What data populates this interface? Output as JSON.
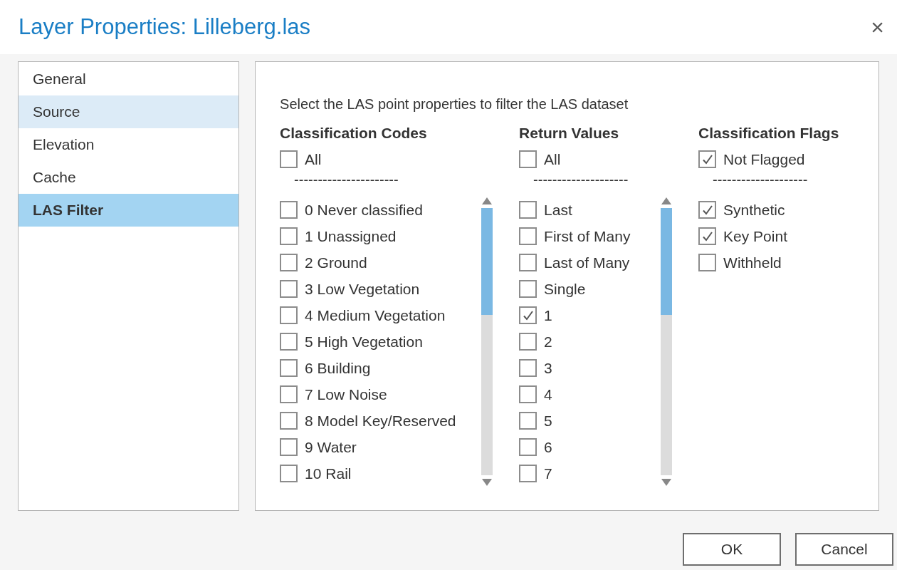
{
  "window": {
    "title": "Layer Properties: Lilleberg.las",
    "close": "×"
  },
  "sidebar": {
    "items": [
      {
        "label": "General",
        "selected": false,
        "hovered": false
      },
      {
        "label": "Source",
        "selected": false,
        "hovered": true
      },
      {
        "label": "Elevation",
        "selected": false,
        "hovered": false
      },
      {
        "label": "Cache",
        "selected": false,
        "hovered": false
      },
      {
        "label": "LAS Filter",
        "selected": true,
        "hovered": false
      }
    ]
  },
  "panel": {
    "instruction": "Select the LAS point properties to filter the LAS dataset",
    "groups": [
      {
        "heading": "Classification Codes",
        "all": {
          "label": "All",
          "checked": false
        },
        "separator": "----------------------",
        "scrollable": true,
        "items": [
          {
            "label": "0 Never classified",
            "checked": false
          },
          {
            "label": "1 Unassigned",
            "checked": false
          },
          {
            "label": "2 Ground",
            "checked": false
          },
          {
            "label": "3 Low Vegetation",
            "checked": false
          },
          {
            "label": "4 Medium Vegetation",
            "checked": false
          },
          {
            "label": "5 High Vegetation",
            "checked": false
          },
          {
            "label": "6 Building",
            "checked": false
          },
          {
            "label": "7 Low Noise",
            "checked": false
          },
          {
            "label": "8 Model Key/Reserved",
            "checked": false
          },
          {
            "label": "9 Water",
            "checked": false
          },
          {
            "label": "10 Rail",
            "checked": false
          }
        ]
      },
      {
        "heading": "Return Values",
        "all": {
          "label": "All",
          "checked": false
        },
        "separator": "--------------------",
        "scrollable": true,
        "items": [
          {
            "label": "Last",
            "checked": false
          },
          {
            "label": "First of Many",
            "checked": false
          },
          {
            "label": "Last of Many",
            "checked": false
          },
          {
            "label": "Single",
            "checked": false
          },
          {
            "label": "1",
            "checked": true
          },
          {
            "label": "2",
            "checked": false
          },
          {
            "label": "3",
            "checked": false
          },
          {
            "label": "4",
            "checked": false
          },
          {
            "label": "5",
            "checked": false
          },
          {
            "label": "6",
            "checked": false
          },
          {
            "label": "7",
            "checked": false
          }
        ]
      },
      {
        "heading": "Classification Flags",
        "all": {
          "label": "Not Flagged",
          "checked": true
        },
        "separator": "--------------------",
        "scrollable": false,
        "items": [
          {
            "label": "Synthetic",
            "checked": true
          },
          {
            "label": "Key Point",
            "checked": true
          },
          {
            "label": "Withheld",
            "checked": false
          }
        ]
      }
    ]
  },
  "buttons": [
    "OK",
    "Cancel"
  ]
}
